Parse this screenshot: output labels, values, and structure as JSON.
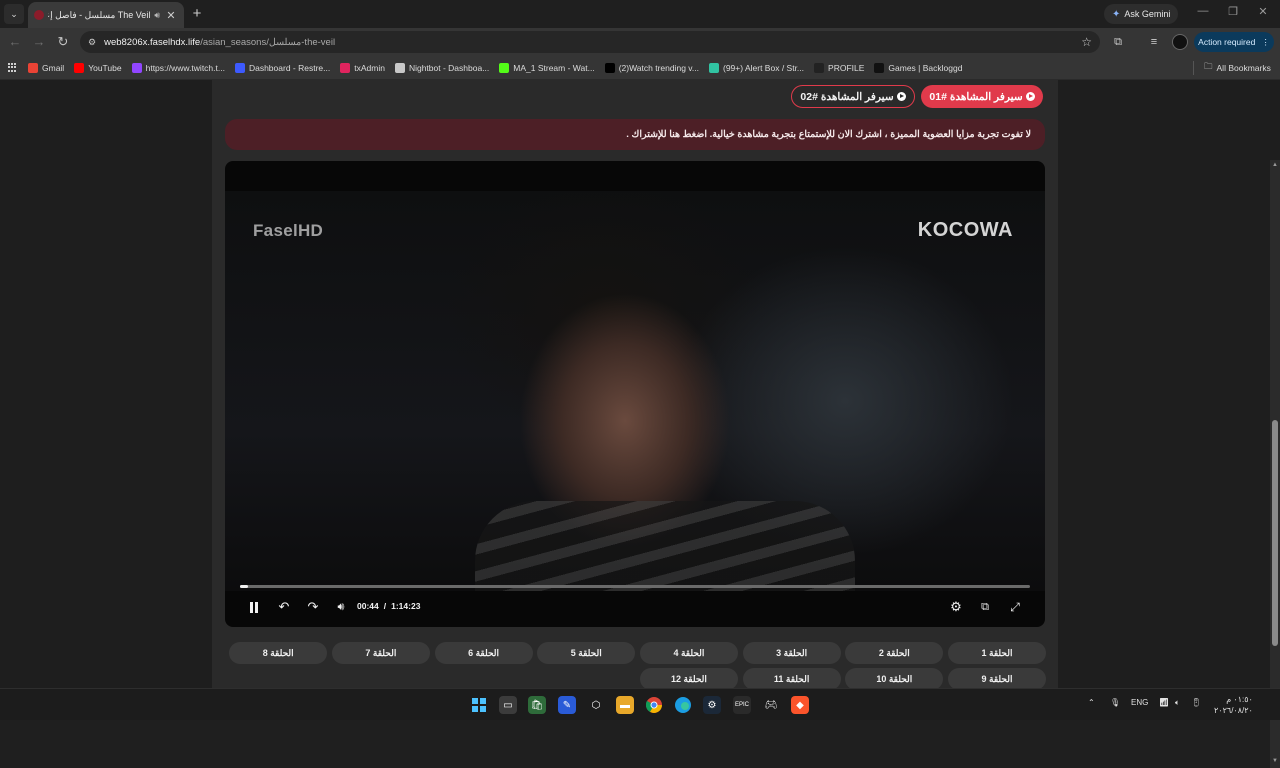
{
  "browser": {
    "tab_title": "The Veil مسلسل - فاصل إعلا",
    "new_tab": "+",
    "gemini_label": "Ask Gemini",
    "url_host": "web8206x.faselhdx.life",
    "url_path": "/asian_seasons/مسلسل-the-veil",
    "action_label": "Action required",
    "all_bookmarks": "All Bookmarks"
  },
  "bookmarks": [
    {
      "label": "Gmail",
      "icon": "gmail-icon",
      "color": "#ea4335"
    },
    {
      "label": "YouTube",
      "icon": "youtube-icon",
      "color": "#ff0000"
    },
    {
      "label": "https://www.twitch.t...",
      "icon": "twitch-icon",
      "color": "#9146ff"
    },
    {
      "label": "Dashboard - Restre...",
      "icon": "restream-icon",
      "color": "#3d5afe"
    },
    {
      "label": "txAdmin",
      "icon": "txadmin-icon",
      "color": "#e0245e"
    },
    {
      "label": "Nightbot - Dashboa...",
      "icon": "nightbot-icon",
      "color": "#c8c8c8"
    },
    {
      "label": "MA_1 Stream - Wat...",
      "icon": "kick-icon",
      "color": "#53fc18"
    },
    {
      "label": "(2)Watch trending v...",
      "icon": "tiktok-icon",
      "color": "#000000"
    },
    {
      "label": "(99+) Alert Box / Str...",
      "icon": "streamlabs-icon",
      "color": "#31c3a2"
    },
    {
      "label": "PROFILE",
      "icon": "profile-icon",
      "color": "#222222"
    },
    {
      "label": "Games | Backloggd",
      "icon": "backloggd-icon",
      "color": "#111111"
    }
  ],
  "servers": {
    "server1": "سيرفر المشاهدة #01",
    "server2": "سيرفر المشاهدة #02"
  },
  "banner_text": "لا تفوت تجربة مزايا العضوية المميزة ، اشترك الان للإستمتاع بتجربة مشاهدة خيالية. اضغط هنا للإشتراك .",
  "player": {
    "watermark_left": "FaselHD",
    "watermark_right": "KOCOWA",
    "current_time": "00:44",
    "separator": "/",
    "duration": "1:14:23",
    "progress_fraction": 0.0099
  },
  "episodes": [
    "الحلقة 1",
    "الحلقة 2",
    "الحلقة 3",
    "الحلقة 4",
    "الحلقة 5",
    "الحلقة 6",
    "الحلقة 7",
    "الحلقة 8",
    "الحلقة 9",
    "الحلقة 10",
    "الحلقة 11",
    "الحلقة 12"
  ],
  "taskbar": {
    "lang": "ENG",
    "clock_time": "٠١:٥٠ م",
    "clock_date": "٢٠٢٦/٠٨/٢٠"
  },
  "colors": {
    "accent": "#e03a4b",
    "banner_bg": "#4d1f26",
    "action_bg": "#0b3a5c"
  }
}
